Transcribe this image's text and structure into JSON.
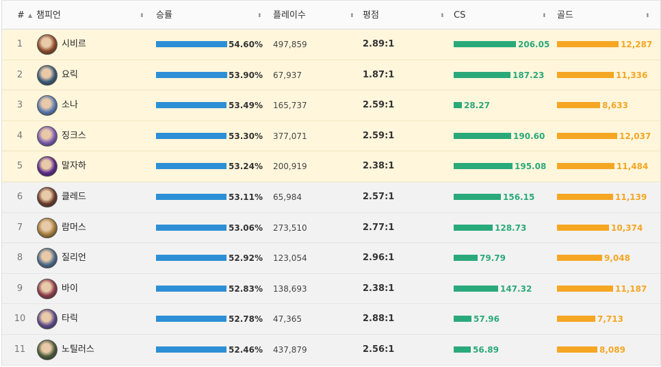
{
  "header": {
    "rank": "#",
    "champion": "챔피언",
    "winrate": "승률",
    "plays": "플레이수",
    "kda": "평점",
    "cs": "CS",
    "gold": "골드"
  },
  "colors": {
    "winrate_bar": "#2d8fd5",
    "cs_bar": "#2aa97a",
    "gold_bar": "#f5a623",
    "top_row_bg": "#fff6dc",
    "normal_row_bg": "#f2f2f2"
  },
  "rows": [
    {
      "rank": "1",
      "name": "시비르",
      "winrate": "54.60%",
      "plays": "497,859",
      "kda": "2.89:1",
      "cs": "206.05",
      "gold": "12,287",
      "highlight": true,
      "avatar_color": "#8a4a2a"
    },
    {
      "rank": "2",
      "name": "요릭",
      "winrate": "53.90%",
      "plays": "67,937",
      "kda": "1.87:1",
      "cs": "187.23",
      "gold": "11,336",
      "highlight": true,
      "avatar_color": "#3a5a7a"
    },
    {
      "rank": "3",
      "name": "소나",
      "winrate": "53.49%",
      "plays": "165,737",
      "kda": "2.59:1",
      "cs": "28.27",
      "gold": "8,633",
      "highlight": true,
      "avatar_color": "#5a7ab0"
    },
    {
      "rank": "4",
      "name": "징크스",
      "winrate": "53.30%",
      "plays": "377,071",
      "kda": "2.59:1",
      "cs": "190.60",
      "gold": "12,037",
      "highlight": true,
      "avatar_color": "#7a5ab0"
    },
    {
      "rank": "5",
      "name": "말자하",
      "winrate": "53.24%",
      "plays": "200,919",
      "kda": "2.38:1",
      "cs": "195.08",
      "gold": "11,484",
      "highlight": true,
      "avatar_color": "#5a2a8a"
    },
    {
      "rank": "6",
      "name": "클레드",
      "winrate": "53.11%",
      "plays": "65,984",
      "kda": "2.57:1",
      "cs": "156.15",
      "gold": "11,139",
      "highlight": false,
      "avatar_color": "#6a3a2a"
    },
    {
      "rank": "7",
      "name": "람머스",
      "winrate": "53.06%",
      "plays": "273,510",
      "kda": "2.77:1",
      "cs": "128.73",
      "gold": "10,374",
      "highlight": false,
      "avatar_color": "#a07a3a"
    },
    {
      "rank": "8",
      "name": "질리언",
      "winrate": "52.92%",
      "plays": "123,054",
      "kda": "2.96:1",
      "cs": "79.79",
      "gold": "9,048",
      "highlight": false,
      "avatar_color": "#4a6a8a"
    },
    {
      "rank": "9",
      "name": "바이",
      "winrate": "52.83%",
      "plays": "138,693",
      "kda": "2.38:1",
      "cs": "147.32",
      "gold": "11,187",
      "highlight": false,
      "avatar_color": "#8a3a4a"
    },
    {
      "rank": "10",
      "name": "타릭",
      "winrate": "52.78%",
      "plays": "47,365",
      "kda": "2.88:1",
      "cs": "57.96",
      "gold": "7,713",
      "highlight": false,
      "avatar_color": "#5a4a8a"
    },
    {
      "rank": "11",
      "name": "노틸러스",
      "winrate": "52.46%",
      "plays": "437,879",
      "kda": "2.56:1",
      "cs": "56.89",
      "gold": "8,089",
      "highlight": false,
      "avatar_color": "#4a5a3a"
    }
  ]
}
